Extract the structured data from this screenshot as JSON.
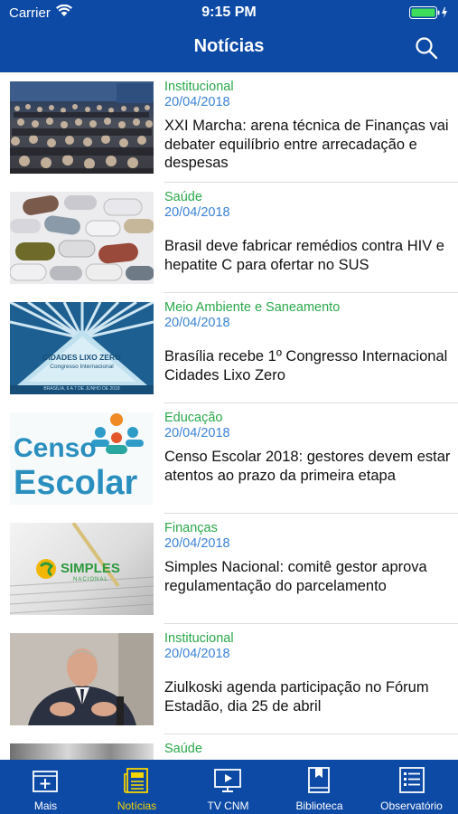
{
  "status_bar": {
    "carrier": "Carrier",
    "time": "9:15 PM"
  },
  "header": {
    "title": "Notícias",
    "search_icon": "search-icon"
  },
  "articles": [
    {
      "category": "Institucional",
      "date": "20/04/2018",
      "title": "XXI Marcha: arena técnica de Finanças vai debater equilíbrio entre arrecadação e despesas",
      "image": "crowd-photo"
    },
    {
      "category": "Saúde",
      "date": "20/04/2018",
      "title": "Brasil deve fabricar remédios contra HIV e hepatite C para ofertar no SUS",
      "image": "pills-photo"
    },
    {
      "category": "Meio Ambiente e Saneamento",
      "date": "20/04/2018",
      "title": "Brasília recebe 1º Congresso Internacional Cidades Lixo Zero",
      "image": "cidades-lixo-zero-poster",
      "image_text": [
        "CIDADES LIXO ZERO",
        "Congresso Internacional",
        "BRASÍLIA, 6 A 7 DE JUNHO DE 2018"
      ]
    },
    {
      "category": "Educação",
      "date": "20/04/2018",
      "title": "Censo Escolar 2018: gestores devem estar atentos ao prazo da primeira etapa",
      "image": "censo-escolar-logo",
      "image_text": [
        "Censo",
        "Escolar"
      ]
    },
    {
      "category": "Finanças",
      "date": "20/04/2018",
      "title": "Simples Nacional: comitê gestor aprova regulamentação do parcelamento",
      "image": "simples-nacional-photo",
      "image_text": [
        "SIMPLES",
        "NACIONAL"
      ]
    },
    {
      "category": "Institucional",
      "date": "20/04/2018",
      "title": "Ziulkoski agenda participação no Fórum Estadão, dia 25 de abril",
      "image": "speaker-photo"
    },
    {
      "category": "Saúde",
      "date": "",
      "title": "",
      "image": "building-photo"
    }
  ],
  "tabbar": {
    "tabs": [
      {
        "label": "Mais",
        "icon": "add-box-icon",
        "active": false
      },
      {
        "label": "Notícias",
        "icon": "newspaper-icon",
        "active": true
      },
      {
        "label": "TV CNM",
        "icon": "tv-icon",
        "active": false
      },
      {
        "label": "Biblioteca",
        "icon": "book-icon",
        "active": false
      },
      {
        "label": "Observatório",
        "icon": "list-icon",
        "active": false
      }
    ]
  },
  "colors": {
    "brand": "#0d4aa6",
    "category": "#2aa84a",
    "date": "#3b83d6",
    "active_tab": "#f5d400"
  }
}
